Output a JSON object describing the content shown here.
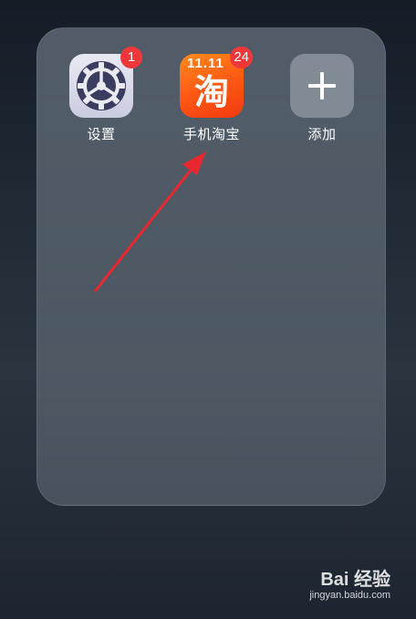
{
  "folder": {
    "apps": [
      {
        "label": "设置",
        "badge": "1",
        "icon": "gear-icon"
      },
      {
        "label": "手机淘宝",
        "badge": "24",
        "icon": "taobao-icon",
        "icon_text": "淘",
        "icon_sale": "11.11"
      },
      {
        "label": "添加",
        "icon": "plus-icon"
      }
    ]
  },
  "annotation": {
    "color": "#e8282e",
    "icon": "arrow-icon"
  },
  "watermark": {
    "logo": "Bai 经验",
    "url": "jingyan.baidu.com"
  }
}
